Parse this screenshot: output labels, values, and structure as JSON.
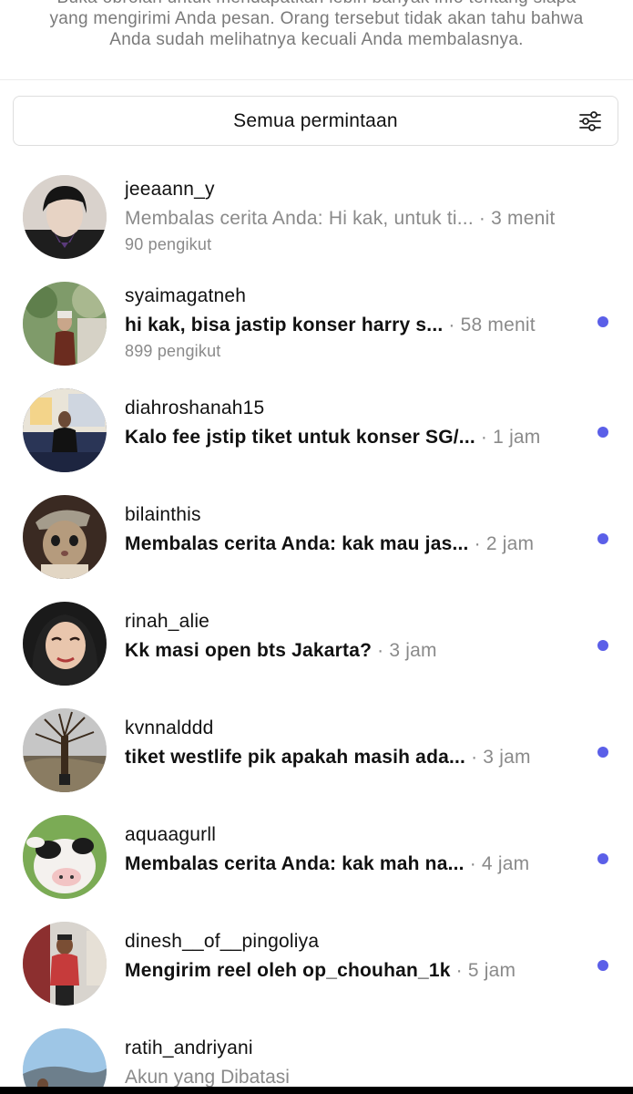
{
  "notice": {
    "line1": "Buka obrolan untuk mendapatkan lebih banyak info tentang siapa",
    "line2": "yang mengirimi Anda pesan. Orang tersebut tidak akan tahu bahwa",
    "line3": "Anda sudah melihatnya kecuali Anda membalasnya."
  },
  "filter": {
    "label": "Semua permintaan",
    "icon": "sliders-icon"
  },
  "requests": [
    {
      "username": "jeeaann_y",
      "message": "Membalas cerita Anda: Hi kak, untuk ti...",
      "time": "· 3 menit",
      "followers": "90 pengikut",
      "unread": false
    },
    {
      "username": "syaimagatneh",
      "message": "hi kak, bisa jastip konser harry s...",
      "time": "· 58 menit",
      "followers": "899 pengikut",
      "unread": true
    },
    {
      "username": "diahroshanah15",
      "message": "Kalo fee jstip tiket untuk konser SG/...",
      "time": "· 1 jam",
      "followers": "",
      "unread": true
    },
    {
      "username": "bilainthis",
      "message": "Membalas cerita Anda: kak mau jas...",
      "time": "· 2 jam",
      "followers": "",
      "unread": true
    },
    {
      "username": "rinah_alie",
      "message": "Kk masi open bts Jakarta?",
      "time": "· 3 jam",
      "followers": "",
      "unread": true
    },
    {
      "username": "kvnnalddd",
      "message": "tiket westlife pik apakah masih ada...",
      "time": "· 3 jam",
      "followers": "",
      "unread": true
    },
    {
      "username": "aquaagurll",
      "message": "Membalas cerita Anda: kak mah na...",
      "time": "· 4 jam",
      "followers": "",
      "unread": true
    },
    {
      "username": "dinesh__of__pingoliya",
      "message": "Mengirim reel oleh op_chouhan_1k",
      "time": "· 5 jam",
      "followers": "",
      "unread": true
    },
    {
      "username": "ratih_andriyani",
      "message": "Akun yang Dibatasi",
      "time": "",
      "followers": "",
      "unread": false
    }
  ],
  "colors": {
    "unread_dot": "#5b5fe8",
    "secondary_text": "#8a8a8a",
    "primary_text": "#111111"
  }
}
